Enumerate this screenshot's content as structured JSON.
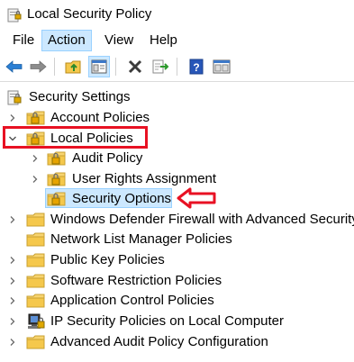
{
  "window": {
    "title": "Local Security Policy"
  },
  "menu": {
    "items": [
      {
        "label": "File"
      },
      {
        "label": "Action"
      },
      {
        "label": "View"
      },
      {
        "label": "Help"
      }
    ]
  },
  "toolbar": {
    "buttons": [
      {
        "icon": "back-arrow-icon"
      },
      {
        "icon": "forward-arrow-icon"
      },
      {
        "icon": "up-folder-icon"
      },
      {
        "icon": "show-hide-tree-icon"
      },
      {
        "icon": "delete-icon"
      },
      {
        "icon": "export-list-icon"
      },
      {
        "icon": "help-icon"
      },
      {
        "icon": "properties-icon"
      }
    ]
  },
  "tree": {
    "root": "Security Settings",
    "items": [
      {
        "label": "Account Policies"
      },
      {
        "label": "Local Policies"
      },
      {
        "label": "Audit Policy"
      },
      {
        "label": "User Rights Assignment"
      },
      {
        "label": "Security Options"
      },
      {
        "label": "Windows Defender Firewall with Advanced Security"
      },
      {
        "label": "Network List Manager Policies"
      },
      {
        "label": "Public Key Policies"
      },
      {
        "label": "Software Restriction Policies"
      },
      {
        "label": "Application Control Policies"
      },
      {
        "label": "IP Security Policies on Local Computer"
      },
      {
        "label": "Advanced Audit Policy Configuration"
      }
    ]
  },
  "annotations": {
    "box_color": "#e81123",
    "arrow_color": "#e81123"
  }
}
